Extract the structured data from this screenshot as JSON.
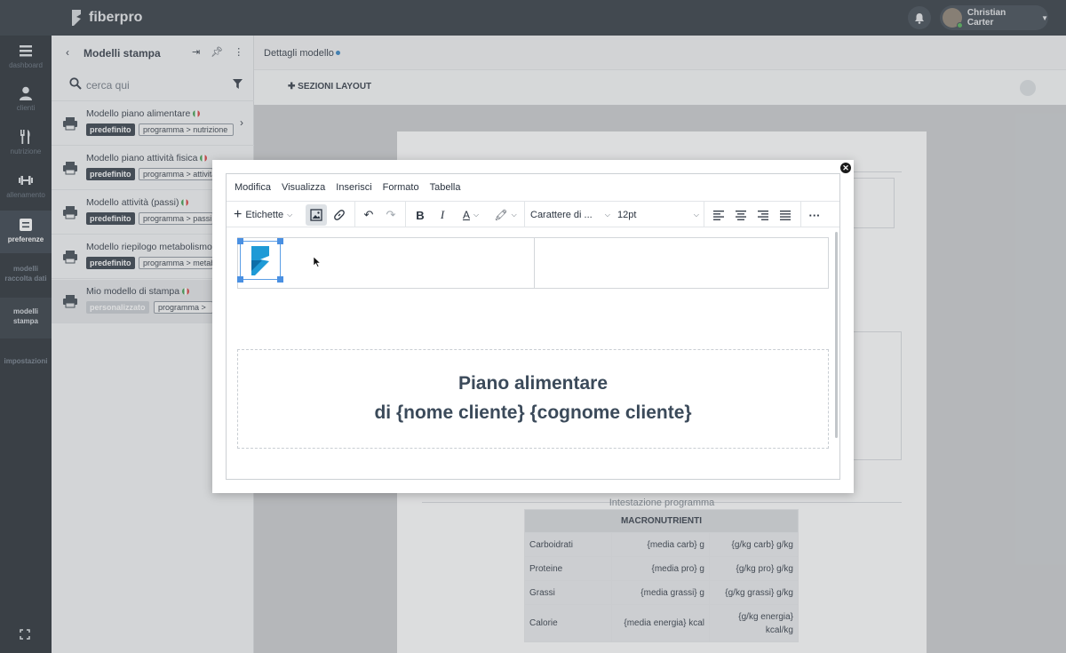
{
  "app": {
    "brand": "fiberpro"
  },
  "user": {
    "name": "Christian Carter"
  },
  "nav": {
    "items": [
      {
        "label": "dashboard"
      },
      {
        "label": "clienti"
      },
      {
        "label": "nutrizione"
      },
      {
        "label": "allenamento"
      },
      {
        "label": "preferenze"
      }
    ],
    "sub": [
      {
        "label": "modelli raccolta dati"
      },
      {
        "label": "modelli stampa"
      },
      {
        "label": "impostazioni"
      }
    ]
  },
  "list": {
    "title": "Modelli stampa",
    "search_placeholder": "cerca qui",
    "models": [
      {
        "name": "Modello piano alimentare",
        "badge": "predefinito",
        "category": "programma > nutrizione"
      },
      {
        "name": "Modello piano attività fisica",
        "badge": "predefinito",
        "category": "programma > attività"
      },
      {
        "name": "Modello attività (passi)",
        "badge": "predefinito",
        "category": "programma > passi"
      },
      {
        "name": "Modello riepilogo metabolismo",
        "badge": "predefinito",
        "category": "programma > metabolismo"
      },
      {
        "name": "Mio modello di stampa",
        "badge": "personalizzato",
        "category": "programma > "
      }
    ]
  },
  "main": {
    "header": "Dettagli modello",
    "section_label": "SEZIONI LAYOUT",
    "program_label": "Intestazione programma",
    "macro": {
      "title": "MACRONUTRIENTI",
      "rows": [
        [
          "Carboidrati",
          "{media carb} g",
          "{g/kg carb} g/kg"
        ],
        [
          "Proteine",
          "{media pro} g",
          "{g/kg pro} g/kg"
        ],
        [
          "Grassi",
          "{media grassi} g",
          "{g/kg grassi} g/kg"
        ],
        [
          "Calorie",
          "{media energia} kcal",
          "{g/kg energia} kcal/kg"
        ]
      ]
    }
  },
  "editor": {
    "menu": [
      "Modifica",
      "Visualizza",
      "Inserisci",
      "Formato",
      "Tabella"
    ],
    "tags_label": "Etichette",
    "font_family": "Carattere di ...",
    "font_size": "12pt",
    "title_line1": "Piano alimentare",
    "title_line2": "di {nome cliente} {cognome cliente}"
  },
  "colors": {
    "topbar": "#2a323b",
    "sidebar": "#1f262d",
    "accent_blue": "#2d7fc1",
    "selection_handle": "#4a90e2"
  }
}
